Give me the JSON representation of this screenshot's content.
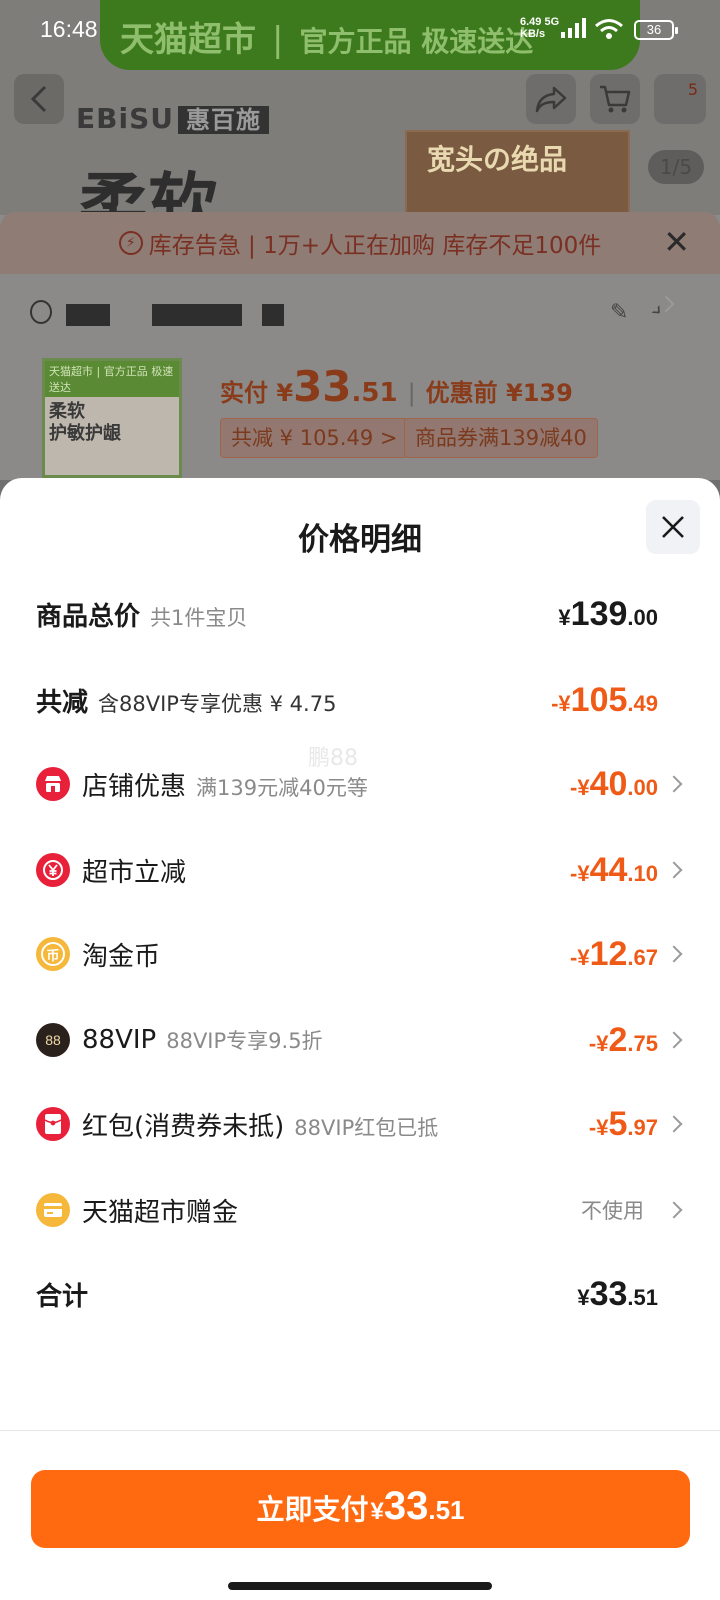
{
  "status_bar": {
    "time": "16:48",
    "net_speed_value": "6.49",
    "net_speed_unit": "KB/s",
    "network": "5G",
    "battery": "36"
  },
  "background": {
    "banner_main": "天猫超市",
    "banner_sep": "|",
    "banner_tag": "官方正品 极速送达",
    "brand": "EBiSU",
    "brand_cn": "惠百施",
    "big_text": "柔软",
    "box_text": "宽头の绝品",
    "image_counter": "1/5",
    "cart_badge": "5",
    "alert_text": "库存告急 | 1万+人正在加购  库存不足100件",
    "thumb_tag": "天猫超市 | 官方正品 极速送达",
    "thumb_text": "柔软\n护敏护龈",
    "pay_label": "实付",
    "pay_currency": "¥",
    "pay_int": "33",
    "pay_dec": ".51",
    "sep": "|",
    "before_label": "优惠前 ¥139",
    "total_saving_chip": "共减 ¥ 105.49 >",
    "coupon_chip": "商品券满139减40"
  },
  "sheet": {
    "title": "价格明细",
    "watermark": "鹏88",
    "rows": [
      {
        "label": "商品总价",
        "sub": "共1件宝贝",
        "cur": "¥",
        "int": "139",
        "dec": ".00"
      },
      {
        "label": "共减",
        "sub": "含88VIP专享优惠 ¥ 4.75",
        "cur": "-¥",
        "int": "105",
        "dec": ".49"
      },
      {
        "label": "店铺优惠",
        "sub": "满139元减40元等",
        "cur": "-¥",
        "int": "40",
        "dec": ".00"
      },
      {
        "label": "超市立减",
        "sub": "",
        "cur": "-¥",
        "int": "44",
        "dec": ".10"
      },
      {
        "label": "淘金币",
        "sub": "",
        "cur": "-¥",
        "int": "12",
        "dec": ".67"
      },
      {
        "label": "88VIP",
        "sub": "88VIP专享9.5折",
        "cur": "-¥",
        "int": "2",
        "dec": ".75"
      },
      {
        "label": "红包(消费券未抵)",
        "sub": "88VIP红包已抵",
        "cur": "-¥",
        "int": "5",
        "dec": ".97"
      },
      {
        "label": "天猫超市赠金",
        "sub": "",
        "value_text": "不使用"
      },
      {
        "label": "合计",
        "sub": "",
        "cur": "¥",
        "int": "33",
        "dec": ".51"
      }
    ],
    "icons": {
      "vip_text": "88",
      "coin_text": "币"
    },
    "pay_button": {
      "label": "立即支付",
      "cur": "¥",
      "int": "33",
      "dec": ".51"
    }
  },
  "colors": {
    "accent_orange": "#ff6a11",
    "discount_red": "#f05a17",
    "icon_red": "#e8203a",
    "icon_gold": "#f5b83a"
  }
}
